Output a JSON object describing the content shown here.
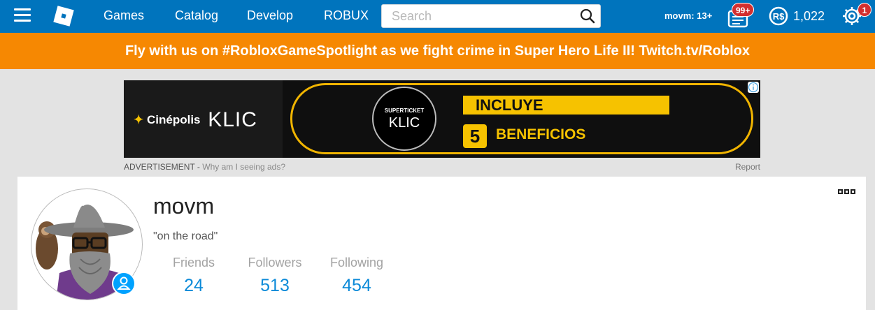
{
  "nav": {
    "links": [
      "Games",
      "Catalog",
      "Develop",
      "ROBUX"
    ],
    "search_placeholder": "Search",
    "user_label": "movm: 13+",
    "messages_badge": "99+",
    "robux_amount": "1,022",
    "settings_badge": "1",
    "colors": {
      "bar": "#0074bd",
      "badge": "#d32f2f"
    }
  },
  "banner": {
    "text": "Fly with us on #RobloxGameSpotlight as we fight crime in Super Hero Life II! Twitch.tv/Roblox",
    "color": "#f68802"
  },
  "ad": {
    "brand": "Cinépolis",
    "brand_product": "KLIC",
    "badge_top": "SUPERTICKET",
    "badge_bottom": "KLIC",
    "headline": "INCLUYE",
    "number": "5",
    "subline": "BENEFICIOS",
    "label": "ADVERTISEMENT",
    "why": "Why am I seeing ads?",
    "report": "Report"
  },
  "profile": {
    "username": "movm",
    "status": "\"on the road\"",
    "stats": [
      {
        "label": "Friends",
        "value": "24"
      },
      {
        "label": "Followers",
        "value": "513"
      },
      {
        "label": "Following",
        "value": "454"
      }
    ],
    "accent_color": "#0c8ad8"
  }
}
